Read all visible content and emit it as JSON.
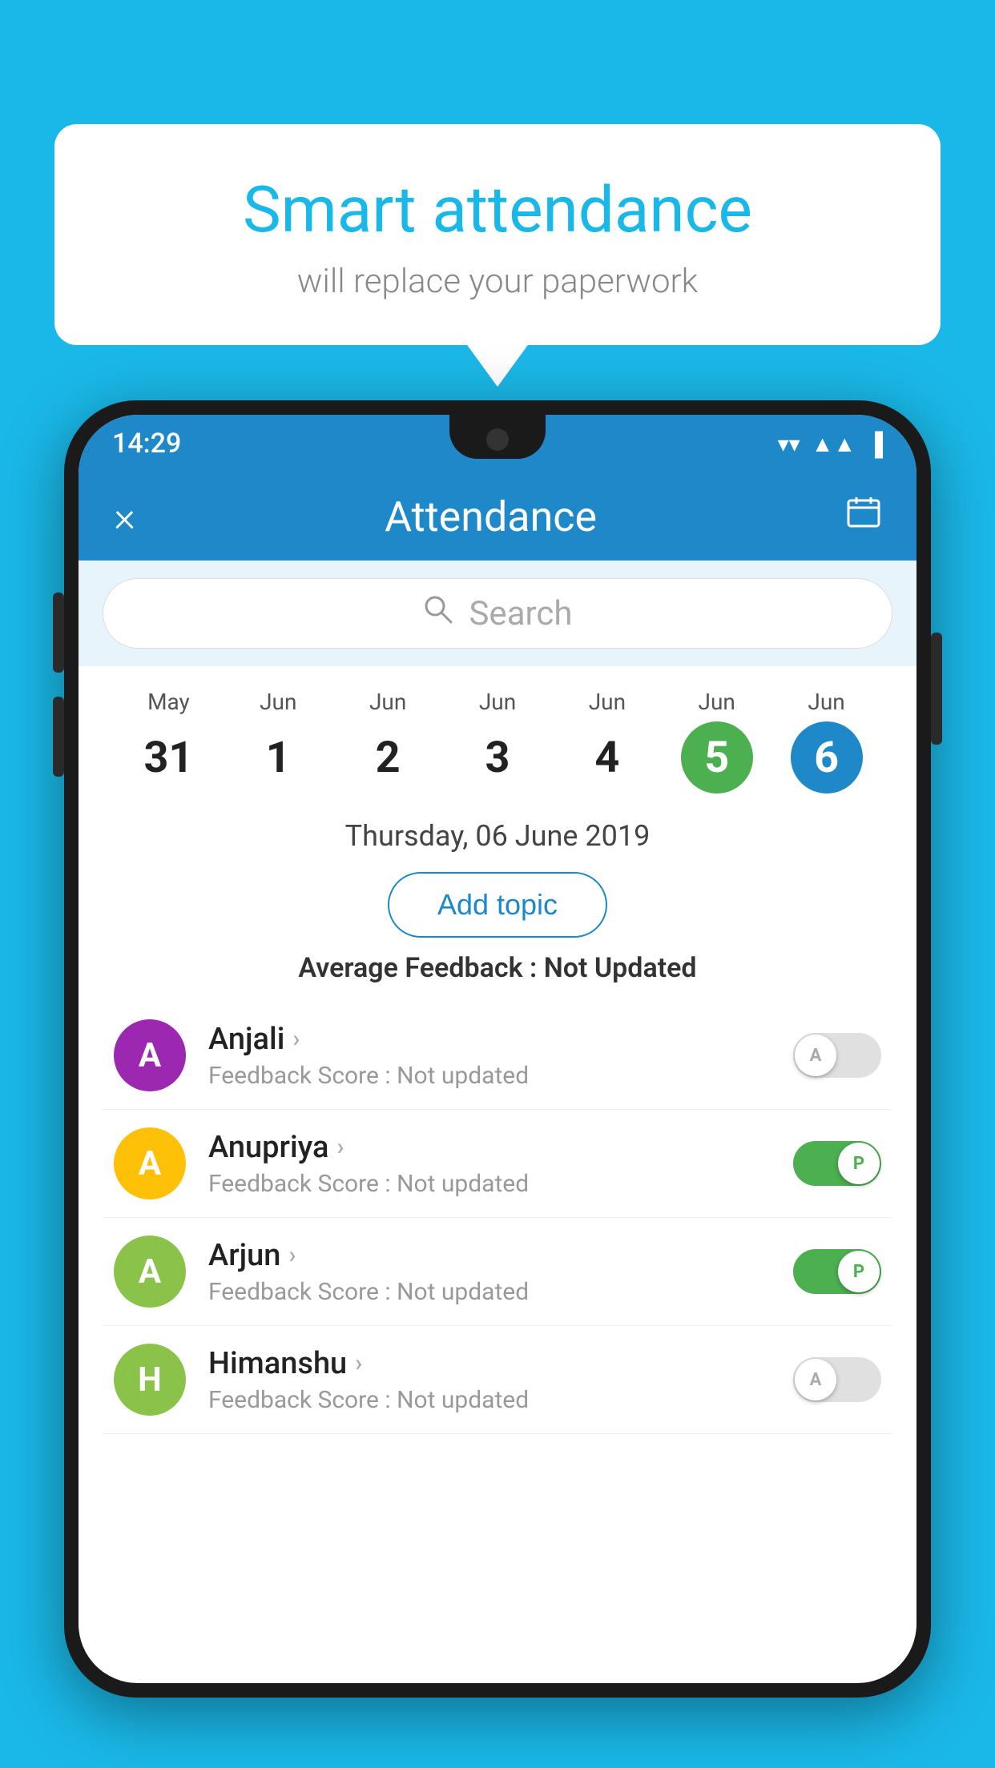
{
  "background_color": "#1ab8e8",
  "bubble": {
    "title": "Smart attendance",
    "subtitle": "will replace your paperwork"
  },
  "phone": {
    "status_bar": {
      "time": "14:29",
      "icons": [
        "wifi",
        "signal",
        "battery"
      ]
    },
    "header": {
      "close_label": "×",
      "title": "Attendance",
      "calendar_icon": "📅"
    },
    "search": {
      "placeholder": "Search"
    },
    "calendar": {
      "days": [
        {
          "month": "May",
          "date": "31",
          "style": "normal"
        },
        {
          "month": "Jun",
          "date": "1",
          "style": "normal"
        },
        {
          "month": "Jun",
          "date": "2",
          "style": "normal"
        },
        {
          "month": "Jun",
          "date": "3",
          "style": "normal"
        },
        {
          "month": "Jun",
          "date": "4",
          "style": "normal"
        },
        {
          "month": "Jun",
          "date": "5",
          "style": "today"
        },
        {
          "month": "Jun",
          "date": "6",
          "style": "selected"
        }
      ]
    },
    "selected_date": "Thursday, 06 June 2019",
    "add_topic_label": "Add topic",
    "avg_feedback_label": "Average Feedback :",
    "avg_feedback_value": "Not Updated",
    "students": [
      {
        "name": "Anjali",
        "avatar_letter": "A",
        "avatar_color": "#9c27b0",
        "feedback_label": "Feedback Score :",
        "feedback_value": "Not updated",
        "toggle": "off",
        "toggle_letter": "A"
      },
      {
        "name": "Anupriya",
        "avatar_letter": "A",
        "avatar_color": "#ffc107",
        "feedback_label": "Feedback Score :",
        "feedback_value": "Not updated",
        "toggle": "on",
        "toggle_letter": "P"
      },
      {
        "name": "Arjun",
        "avatar_letter": "A",
        "avatar_color": "#8bc34a",
        "feedback_label": "Feedback Score :",
        "feedback_value": "Not updated",
        "toggle": "on",
        "toggle_letter": "P"
      },
      {
        "name": "Himanshu",
        "avatar_letter": "H",
        "avatar_color": "#8bc34a",
        "feedback_label": "Feedback Score :",
        "feedback_value": "Not updated",
        "toggle": "off",
        "toggle_letter": "A"
      }
    ]
  }
}
